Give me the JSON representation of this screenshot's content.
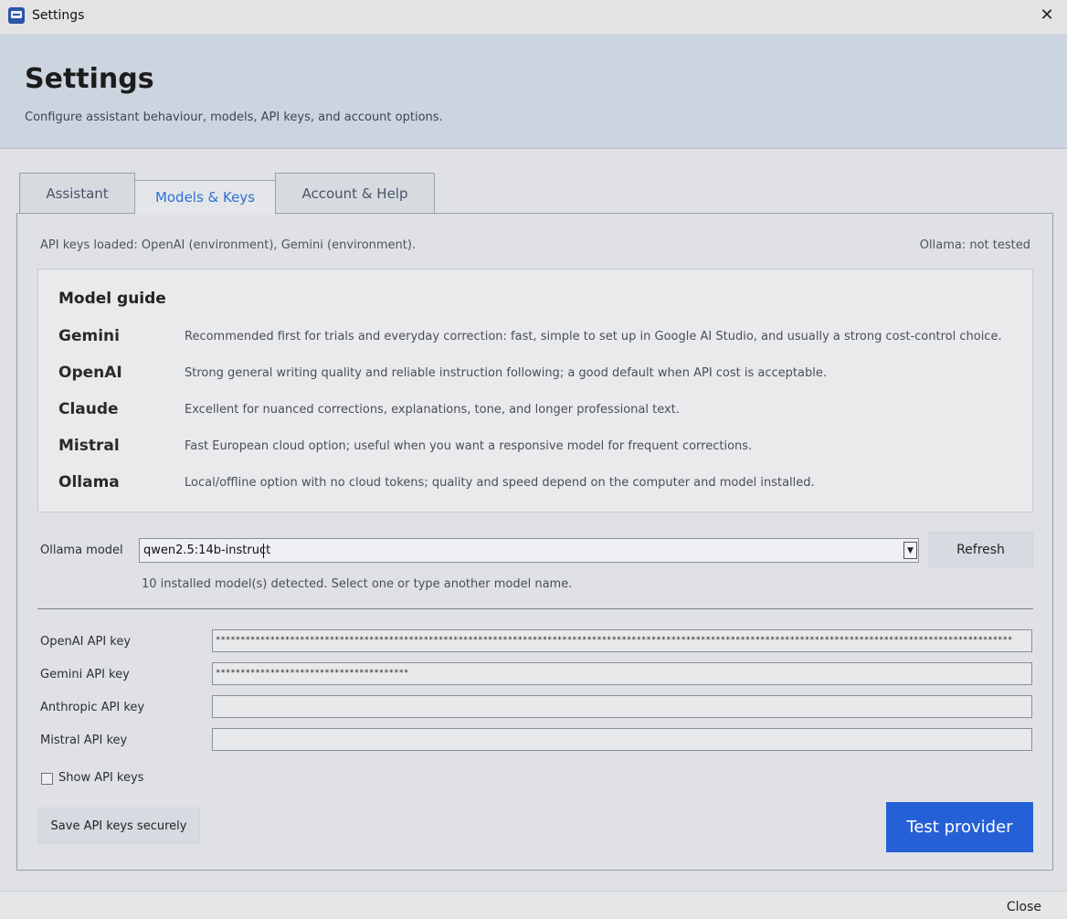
{
  "window": {
    "title": "Settings",
    "close_glyph": "✕"
  },
  "header": {
    "title": "Settings",
    "subtitle": "Configure assistant behaviour, models, API keys, and account options."
  },
  "tabs": [
    {
      "label": "Assistant"
    },
    {
      "label": "Models & Keys"
    },
    {
      "label": "Account & Help"
    }
  ],
  "status": {
    "keys_loaded": "API keys loaded: OpenAI (environment), Gemini (environment).",
    "ollama": "Ollama: not tested"
  },
  "model_guide": {
    "title": "Model guide",
    "items": [
      {
        "name": "Gemini",
        "desc": "Recommended first for trials and everyday correction: fast, simple to set up in Google AI Studio, and usually a strong cost-control choice."
      },
      {
        "name": "OpenAI",
        "desc": "Strong general writing quality and reliable instruction following; a good default when API cost is acceptable."
      },
      {
        "name": "Claude",
        "desc": "Excellent for nuanced corrections, explanations, tone, and longer professional text."
      },
      {
        "name": "Mistral",
        "desc": "Fast European cloud option; useful when you want a responsive model for frequent corrections."
      },
      {
        "name": "Ollama",
        "desc": "Local/offline option with no cloud tokens; quality and speed depend on the computer and model installed."
      }
    ]
  },
  "ollama_model": {
    "label": "Ollama model",
    "value": "qwen2.5:14b-instruct",
    "refresh_label": "Refresh",
    "hint": "10 installed model(s) detected. Select one or type another model name."
  },
  "api_keys": [
    {
      "label": "OpenAI API key",
      "value": "*****************************************************************************************************************************************************************"
    },
    {
      "label": "Gemini API key",
      "value": "***************************************"
    },
    {
      "label": "Anthropic API key",
      "value": ""
    },
    {
      "label": "Mistral API key",
      "value": ""
    }
  ],
  "show_keys": {
    "label": "Show API keys",
    "checked": false
  },
  "actions": {
    "save_label": "Save API keys securely",
    "test_label": "Test provider"
  },
  "footer": {
    "close_label": "Close"
  },
  "colors": {
    "accent": "#2660d6",
    "active_tab_text": "#2f6fd3",
    "header_bg": "#ccd4df"
  }
}
